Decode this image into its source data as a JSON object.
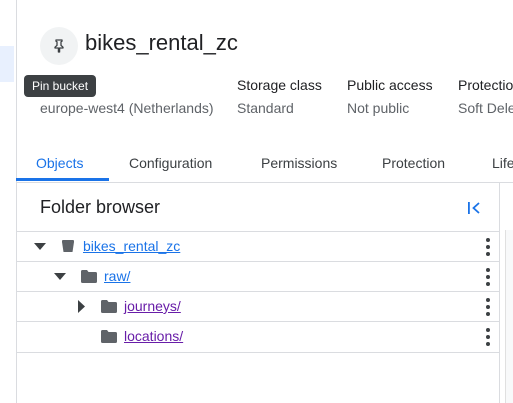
{
  "bucket": {
    "name": "bikes_rental_zc",
    "pin_tooltip": "Pin bucket"
  },
  "meta": [
    {
      "label": "",
      "value": "europe-west4 (Netherlands)"
    },
    {
      "label": "Storage class",
      "value": "Standard"
    },
    {
      "label": "Public access",
      "value": "Not public"
    },
    {
      "label": "Protectio",
      "value": "Soft Dele"
    }
  ],
  "tabs": [
    "Objects",
    "Configuration",
    "Permissions",
    "Protection",
    "Life"
  ],
  "folder_browser": {
    "title": "Folder browser",
    "items": [
      {
        "label": "bikes_rental_zc",
        "type": "bucket",
        "color": "#1a73e8"
      },
      {
        "label": "raw/",
        "type": "folder",
        "color": "#1a73e8"
      },
      {
        "label": "journeys/",
        "type": "folder",
        "color": "#681da8"
      },
      {
        "label": "locations/",
        "type": "folder",
        "color": "#681da8"
      }
    ]
  },
  "colors": {
    "accent": "#1a73e8",
    "visited_link": "#681da8"
  }
}
